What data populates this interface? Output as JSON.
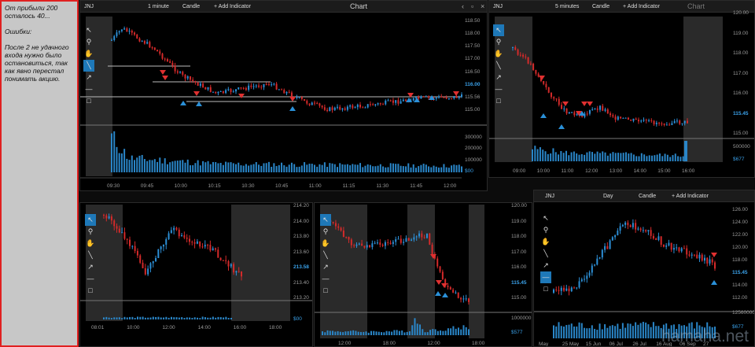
{
  "notes": {
    "line1": "От прибыли 200 осталось 40...",
    "line2": "Ошибки:",
    "line3": "После 2 не удачного входа нужно было остановиться, так как явно перестал понимать акцию."
  },
  "header_icons": [
    "gear-icon",
    "chevron-down-icon",
    "chevron-left-icon",
    "restore-icon",
    "close-icon"
  ],
  "tools": [
    "cursor-icon",
    "zoom-icon",
    "hand-icon",
    "trendline-icon",
    "arrow-icon",
    "hline-icon",
    "rect-icon"
  ],
  "colors": {
    "up": "#2c8fd6",
    "down": "#d42a2a",
    "vol": "#2a86c8",
    "bg": "#000000",
    "shade": "#333333",
    "accent": "#1e78b8"
  },
  "watermark": "hamaha.net",
  "panels": [
    {
      "id": "main",
      "symbol": "JNJ",
      "timeframe": "1 minute",
      "type": "Candle",
      "add": "+ Add Indicator",
      "caption": "Chart",
      "prices": [
        "118.50",
        "118.00",
        "117.50",
        "117.00",
        "116.50",
        "116.00",
        "115.56",
        "115.00"
      ],
      "price_current": "116.00",
      "vols": [
        "300000",
        "200000",
        "100000",
        "$00"
      ],
      "times": [
        "09:30",
        "09:45",
        "10:00",
        "10:15",
        "10:30",
        "10:45",
        "11:00",
        "11:15",
        "11:30",
        "11:45",
        "12:00"
      ]
    },
    {
      "id": "tr",
      "symbol": "JNJ",
      "timeframe": "5 minutes",
      "type": "Candle",
      "add": "+ Add Indicator",
      "caption": "Chart",
      "prices": [
        "120.00",
        "119.00",
        "118.00",
        "117.00",
        "116.00",
        "115.45",
        "115.00"
      ],
      "price_current": "115.45",
      "vols": [
        "500000",
        "$677"
      ],
      "times": [
        "09:00",
        "10:00",
        "11:00",
        "12:00",
        "13:00",
        "14:00",
        "15:00",
        "16:00"
      ]
    },
    {
      "id": "bl",
      "prices": [
        "214.20",
        "214.00",
        "213.80",
        "213.60",
        "213.58",
        "213.40",
        "213.20"
      ],
      "price_current": "213.58",
      "vols": [
        "$00"
      ],
      "times": [
        "08:01",
        "10:00",
        "12:00",
        "14:00",
        "16:00",
        "18:00"
      ]
    },
    {
      "id": "bm",
      "prices": [
        "120.00",
        "119.00",
        "118.00",
        "117.00",
        "116.00",
        "115.45",
        "115.00"
      ],
      "price_current": "115.45",
      "vols": [
        "1000000",
        "$577"
      ],
      "times": [
        "12:00",
        "18:00",
        "12:00",
        "18:00"
      ]
    },
    {
      "id": "br",
      "symbol": "JNJ",
      "timeframe": "Day",
      "type": "Candle",
      "add": "+ Add Indicator",
      "caption": "",
      "prices": [
        "126.00",
        "124.00",
        "122.00",
        "120.00",
        "118.00",
        "115.45",
        "114.00",
        "112.00"
      ],
      "price_current": "115.45",
      "vols": [
        "12560000",
        "$677"
      ],
      "times": [
        "May",
        "25 May",
        "15 Jun",
        "06 Jul",
        "26 Jul",
        "16 Aug",
        "06 Sep",
        "27"
      ]
    }
  ]
}
